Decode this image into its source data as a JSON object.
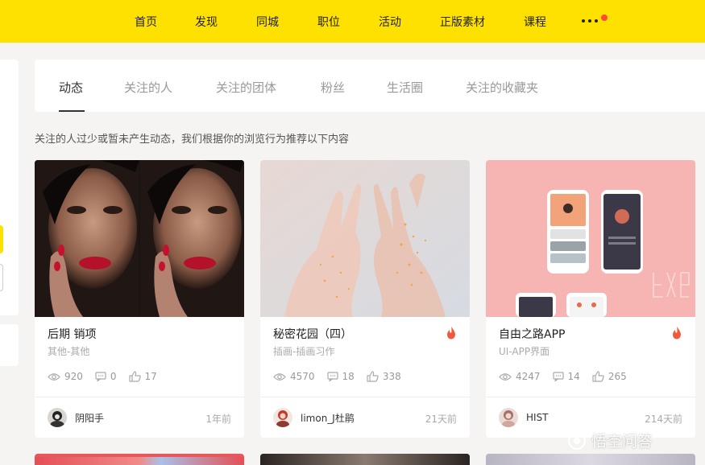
{
  "nav": {
    "items": [
      "首页",
      "发现",
      "同城",
      "职位",
      "活动",
      "正版素材",
      "课程"
    ],
    "more_icon": "more-dots-icon",
    "accent": "#ffe100"
  },
  "tabs": [
    "动态",
    "关注的人",
    "关注的团体",
    "粉丝",
    "生活圈",
    "关注的收藏夹"
  ],
  "notice": "关注的人过少或暂未产生动态，我们根据你的浏览行为推荐以下内容",
  "cards": [
    {
      "title": "后期 销项",
      "category": "其他-其他",
      "views": "920",
      "comments": "0",
      "likes": "17",
      "author": "阴阳手",
      "time": "1年前",
      "hot": false
    },
    {
      "title": "秘密花园（四）",
      "category": "插画-插画习作",
      "views": "4570",
      "comments": "18",
      "likes": "338",
      "author": "limon_J杜鹃",
      "time": "21天前",
      "hot": true
    },
    {
      "title": "自由之路APP",
      "category": "UI-APP界面",
      "views": "4247",
      "comments": "14",
      "likes": "265",
      "author": "HIST",
      "time": "214天前",
      "hot": true
    }
  ],
  "watermark": "悟空问答"
}
